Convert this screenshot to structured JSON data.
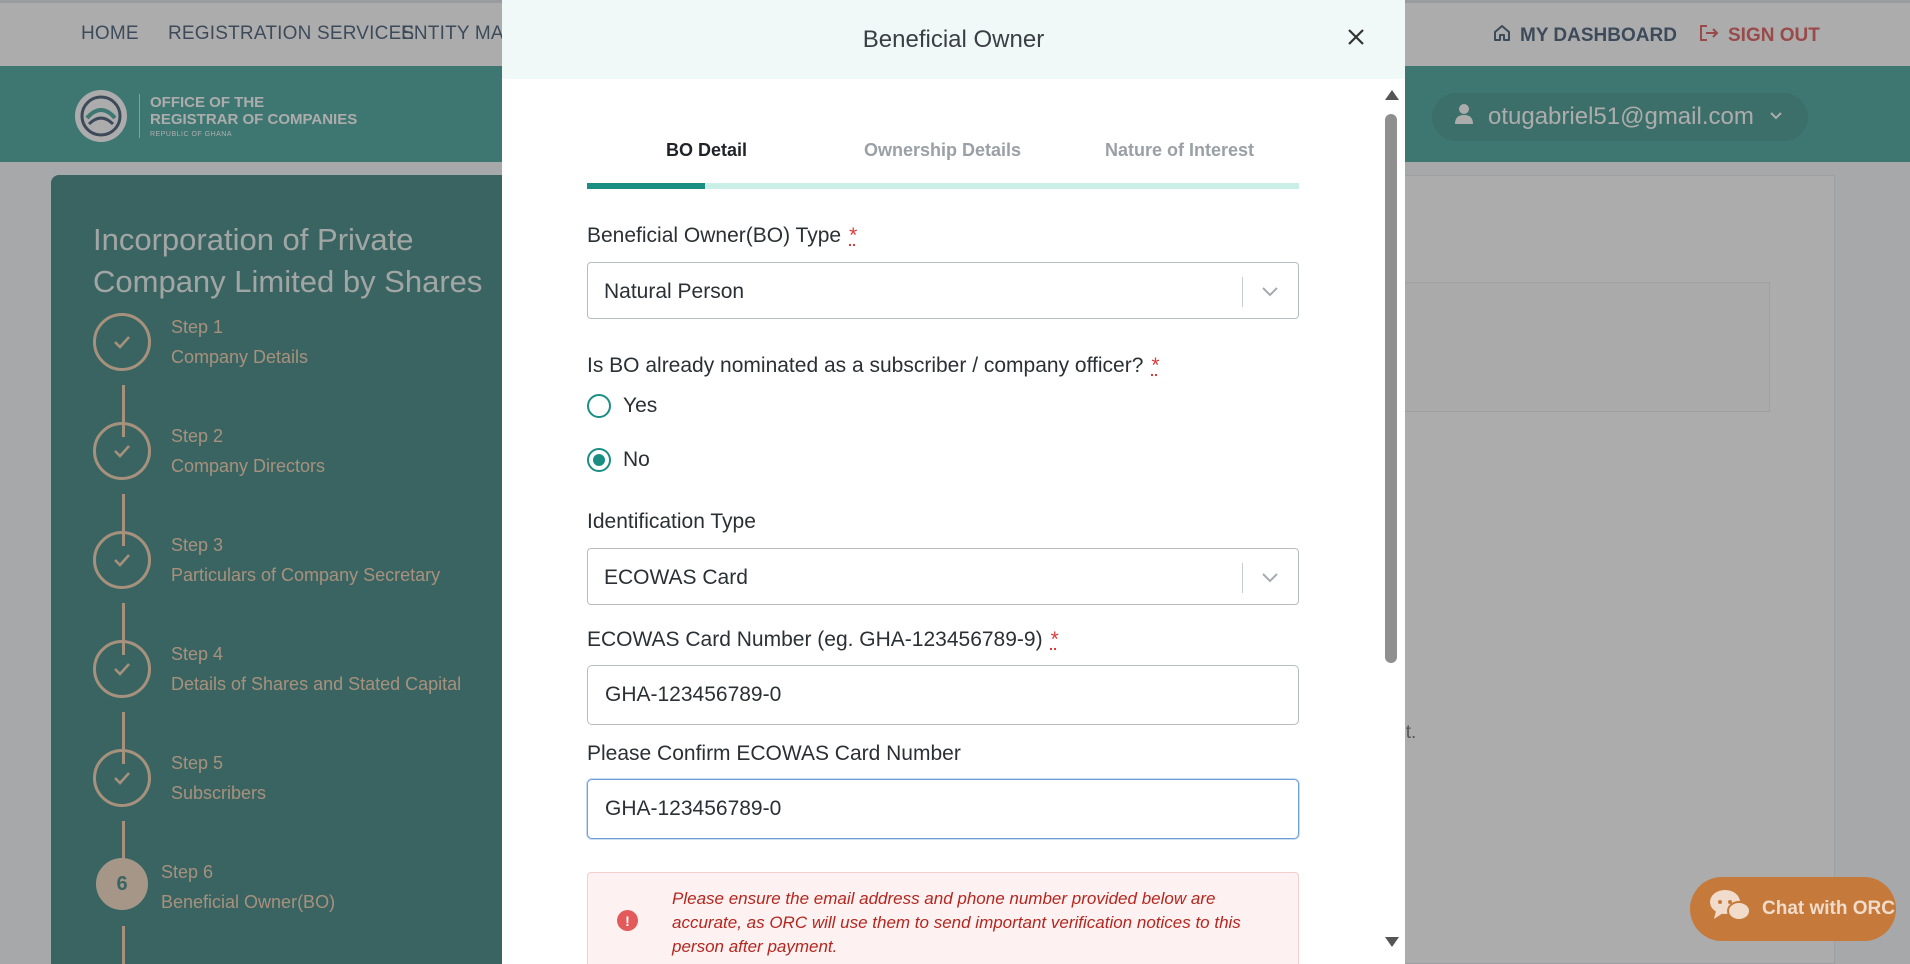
{
  "topnav": {
    "items": [
      "HOME",
      "REGISTRATION SERVICES",
      "ENTITY MAN"
    ],
    "dashboard_label": "MY DASHBOARD",
    "signout_label": "SIGN OUT"
  },
  "banner": {
    "logo_line1": "OFFICE OF THE",
    "logo_line2": "REGISTRAR OF COMPANIES",
    "logo_line3": "REPUBLIC OF GHANA",
    "user_email": "otugabriel51@gmail.com"
  },
  "sidebar": {
    "title": "Incorporation of Private Company Limited by Shares",
    "steps": [
      {
        "num": "Step 1",
        "name": "Company Details",
        "state": "done"
      },
      {
        "num": "Step 2",
        "name": "Company Directors",
        "state": "done"
      },
      {
        "num": "Step 3",
        "name": "Particulars of Company Secretary",
        "state": "done"
      },
      {
        "num": "Step 4",
        "name": "Details of Shares and Stated Capital",
        "state": "done"
      },
      {
        "num": "Step 5",
        "name": "Subscribers",
        "state": "done"
      },
      {
        "num": "Step 6",
        "name": "Beneficial Owner(BO)",
        "state": "active",
        "badge": "6"
      }
    ]
  },
  "main": {
    "partial_text": "ist."
  },
  "chat": {
    "label": "Chat with ORC"
  },
  "modal": {
    "title": "Beneficial Owner",
    "tabs": [
      "BO Detail",
      "Ownership Details",
      "Nature of Interest"
    ],
    "active_tab": "BO Detail",
    "bo_type": {
      "label": "Beneficial Owner(BO) Type",
      "required_mark": "*",
      "value": "Natural Person"
    },
    "nominated": {
      "label": "Is BO already nominated as a subscriber / company officer?",
      "required_mark": "*",
      "options": [
        "Yes",
        "No"
      ],
      "selected": "No"
    },
    "id_type": {
      "label": "Identification Type",
      "value": "ECOWAS Card"
    },
    "card_number": {
      "label": "ECOWAS Card Number (eg. GHA-123456789-9)",
      "required_mark": "*",
      "value": "GHA-123456789-0"
    },
    "confirm_card": {
      "label": "Please Confirm ECOWAS Card Number",
      "value": "GHA-123456789-0"
    },
    "alert": {
      "icon": "!",
      "text": "Please ensure the email address and phone number provided below are accurate, as ORC will use them to send important verification notices to this person after payment."
    }
  },
  "colors": {
    "brand_teal": "#23958a",
    "sidebar_teal": "#1b6e6a",
    "accent_teal": "#1b8e84",
    "signout_red": "#d93a3a",
    "chat_orange": "#c57a3b"
  }
}
